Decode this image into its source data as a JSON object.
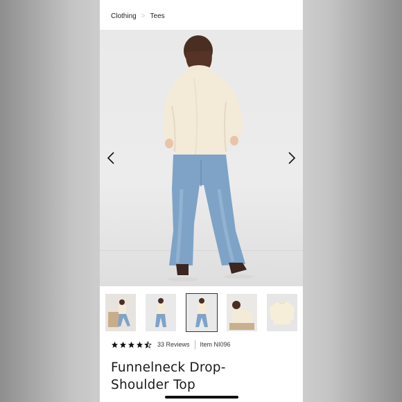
{
  "breadcrumb": {
    "items": [
      "Clothing",
      "Tees"
    ],
    "separator": ">"
  },
  "gallery": {
    "selected_index": 2,
    "thumbnails": [
      "back view standing",
      "front view standing",
      "back view standing",
      "seated close-up",
      "sweater flat lay"
    ]
  },
  "product": {
    "rating": 4.5,
    "review_count_label": "33 Reviews",
    "item_label": "Item NI096",
    "title_line1": "Funnelneck Drop-",
    "title_line2": "Shoulder Top"
  },
  "colors": {
    "sweater": "#f3ead8",
    "denim": "#7fa3c7",
    "star": "#111111"
  }
}
